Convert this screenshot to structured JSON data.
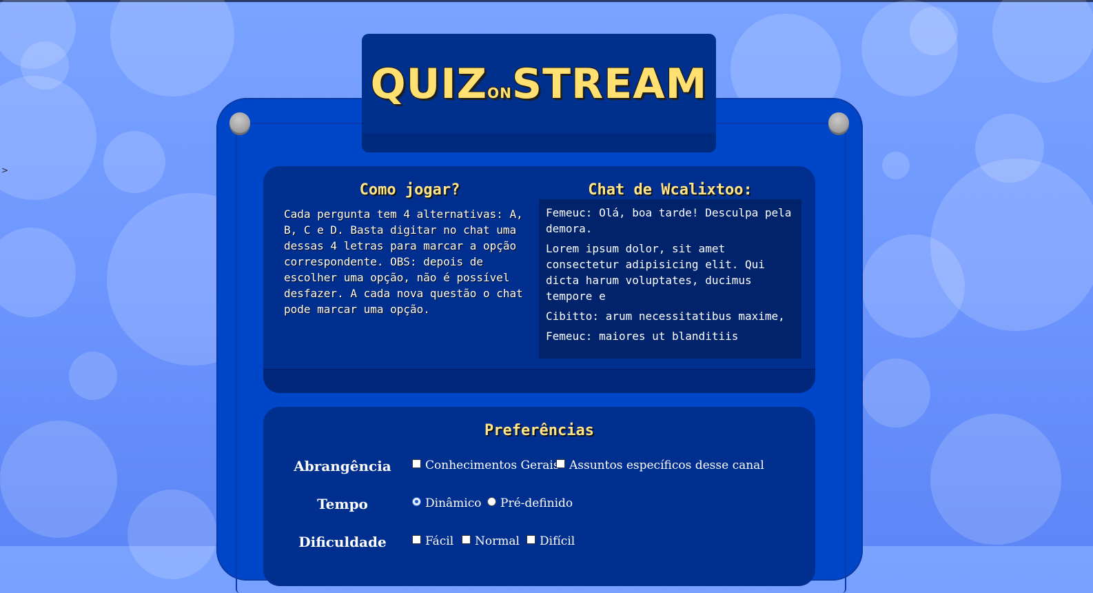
{
  "logo": {
    "part1": "QUIZ",
    "part2": "ON",
    "part3": "STREAM"
  },
  "stray_text": ">",
  "how_to_play": {
    "title": "Como jogar?",
    "text": "Cada pergunta tem 4 alternativas: A, B, C e D. Basta digitar no chat uma dessas 4 letras para marcar a opção correspondente. OBS: depois de escolher uma opção, não é possível desfazer. A cada nova questão o chat pode marcar uma opção."
  },
  "chat": {
    "title": "Chat de Wcalixtoo:",
    "messages": [
      "Femeuc: Olá, boa tarde! Desculpa pela demora.",
      "Lorem ipsum dolor, sit amet consectetur adipisicing elit. Qui dicta harum voluptates, ducimus tempore e",
      "Cibitto: arum necessitatibus maxime,",
      "Femeuc: maiores ut blanditiis"
    ]
  },
  "preferences": {
    "title": "Preferências",
    "rows": [
      {
        "label": "Abrangência",
        "type": "checkbox",
        "options": [
          {
            "label": "Conhecimentos Gerais",
            "checked": false
          },
          {
            "label": "Assuntos específicos desse canal",
            "checked": false
          }
        ]
      },
      {
        "label": "Tempo",
        "type": "radio",
        "options": [
          {
            "label": "Dinâmico",
            "checked": true
          },
          {
            "label": "Pré-definido",
            "checked": false
          }
        ]
      },
      {
        "label": "Dificuldade",
        "type": "checkbox",
        "options": [
          {
            "label": "Fácil",
            "checked": false
          },
          {
            "label": "Normal",
            "checked": false
          },
          {
            "label": "Difícil",
            "checked": false
          }
        ]
      }
    ]
  },
  "colors": {
    "accent_text": "#ffe58a",
    "frame": "#0046c8",
    "panel": "#002f8f",
    "logo": "#ffe070"
  }
}
